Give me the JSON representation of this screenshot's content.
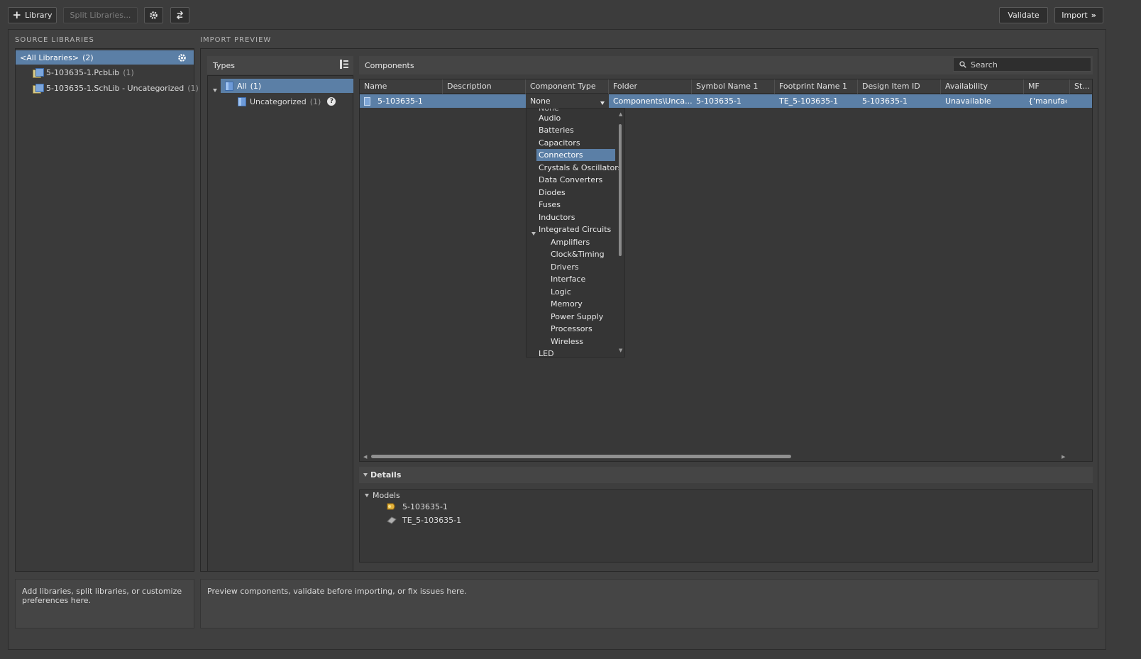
{
  "toolbar": {
    "library_label": "Library",
    "split_label": "Split Libraries...",
    "validate_label": "Validate",
    "import_label": "Import"
  },
  "source_libraries": {
    "title": "SOURCE LIBRARIES",
    "all_label": "<All Libraries>",
    "all_count": "(2)",
    "items": [
      {
        "name": "5-103635-1.PcbLib",
        "count": "(1)"
      },
      {
        "name": "5-103635-1.SchLib - Uncategorized",
        "count": "(1)"
      }
    ],
    "hint": "Add libraries, split libraries, or customize preferences here."
  },
  "import_preview": {
    "title": "IMPORT PREVIEW",
    "types_label": "Types",
    "types": [
      {
        "name": "All",
        "count": "(1)"
      },
      {
        "name": "Uncategorized",
        "count": "(1)"
      }
    ],
    "hint": "Preview components, validate before importing, or fix issues here."
  },
  "components": {
    "label": "Components",
    "search_placeholder": "Search",
    "columns": [
      "Name",
      "Description",
      "Component Type",
      "Folder",
      "Symbol Name 1",
      "Footprint Name 1",
      "Design Item ID",
      "Availability",
      "MF",
      "St..."
    ],
    "row": {
      "name": "5-103635-1",
      "description": "",
      "component_type": "None",
      "folder": "Components\\Unca...",
      "symbol": "5-103635-1",
      "footprint": "TE_5-103635-1",
      "design_item_id": "5-103635-1",
      "availability": "Unavailable",
      "mf": "{'manufactu"
    }
  },
  "component_type_dropdown": {
    "selected": "Connectors",
    "items": [
      "None",
      "Audio",
      "Batteries",
      "Capacitors",
      "Connectors",
      "Crystals & Oscillators",
      "Data Converters",
      "Diodes",
      "Fuses",
      "Inductors",
      "Integrated Circuits",
      "Amplifiers",
      "Clock&Timing",
      "Drivers",
      "Interface",
      "Logic",
      "Memory",
      "Power Supply",
      "Processors",
      "Wireless",
      "LED"
    ]
  },
  "details": {
    "label": "Details",
    "models_label": "Models",
    "models": [
      "5-103635-1",
      "TE_5-103635-1"
    ]
  },
  "colors": {
    "selection": "#5b7fa6",
    "background": "#3c3c3c"
  }
}
